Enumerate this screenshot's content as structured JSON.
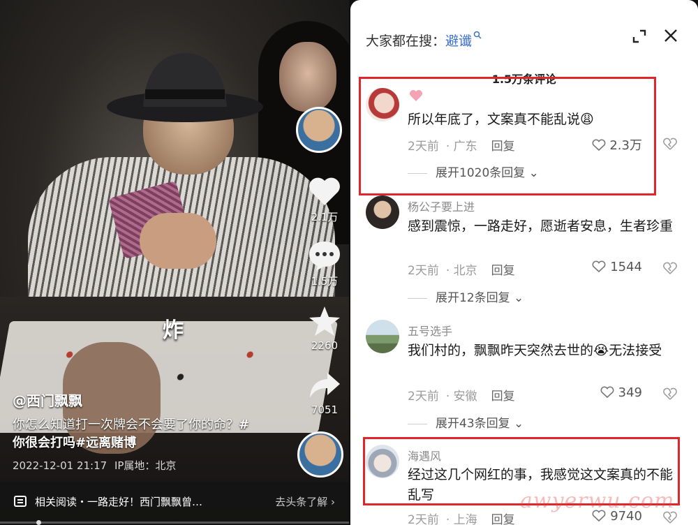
{
  "video": {
    "overlay_text": "炸",
    "author": "@西门飘飘",
    "caption_plain": "你怎么知道打一次牌会不会要了你的命？",
    "caption_tags": "#你很会打吗#远离赌博",
    "date": "2022-12-01 21:17",
    "ip": "IP属地：北京",
    "related_text": "相关阅读・一路走好！西门飘飘曾…",
    "related_link": "去头条了解",
    "likes": "2.1万",
    "comments": "1.5万",
    "favorites": "2260",
    "shares": "7051"
  },
  "panel": {
    "search_label": "大家都在搜：",
    "search_keyword": "避谶",
    "comment_count": "1.5万条评论",
    "comments": [
      {
        "name": "",
        "text": "所以年底了，文案真不能乱说😩",
        "time": "2天前",
        "location": "· 广东",
        "reply": "回复",
        "likes": "2.3万",
        "expand": "展开1020条回复"
      },
      {
        "name": "杨公子要上进",
        "text": "感到震惊，一路走好，愿逝者安息，生者珍重",
        "time": "2天前",
        "location": "· 北京",
        "reply": "回复",
        "likes": "1544",
        "expand": "展开12条回复"
      },
      {
        "name": "五号选手",
        "text": "我们村的，飘飘昨天突然去世的😭无法接受",
        "time": "2天前",
        "location": "· 安徽",
        "reply": "回复",
        "likes": "349",
        "expand": "展开43条回复"
      },
      {
        "name": "海遇风",
        "text": "经过这几个网红的事，我感觉这文案真的不能乱写",
        "time": "2天前",
        "location": "· 上海",
        "reply": "回复",
        "likes": "9740",
        "expand": ""
      }
    ]
  },
  "watermark": "awyerwu.com",
  "colors": {
    "highlight": "#e0252b",
    "link": "#3a6fc8",
    "heart_pink": "#f4a3b4"
  }
}
